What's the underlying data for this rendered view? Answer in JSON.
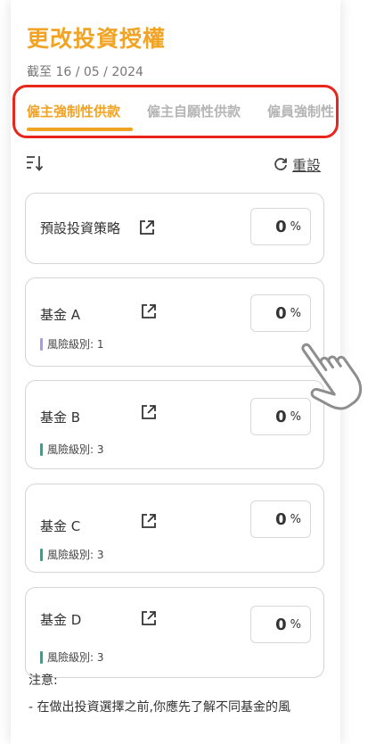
{
  "header": {
    "title": "更改投資授權",
    "date": "截至 16 / 05 / 2024"
  },
  "tabs": [
    {
      "label": "僱主強制性供款",
      "active": true
    },
    {
      "label": "僱主自願性供款",
      "active": false
    },
    {
      "label": "僱員強制性",
      "active": false
    }
  ],
  "toolbar": {
    "sort_icon": "sort-icon",
    "reset_icon": "refresh-icon",
    "reset_label": "重設"
  },
  "default_strategy": {
    "label": "預設投資策略",
    "percent": "0",
    "percent_symbol": "%"
  },
  "funds": [
    {
      "name": "基金 A",
      "risk_label": "風險級別:",
      "risk_level": "1",
      "risk_color": "#a79be8",
      "percent": "0",
      "percent_symbol": "%"
    },
    {
      "name": "基金 B",
      "risk_label": "風險級別:",
      "risk_level": "3",
      "risk_color": "#2aa783",
      "percent": "0",
      "percent_symbol": "%"
    },
    {
      "name": "基金 C",
      "risk_label": "風險級別:",
      "risk_level": "3",
      "risk_color": "#2aa783",
      "percent": "0",
      "percent_symbol": "%"
    },
    {
      "name": "基金 D",
      "risk_label": "風險級別:",
      "risk_level": "3",
      "risk_color": "#2aa783",
      "percent": "0",
      "percent_symbol": "%"
    }
  ],
  "note": {
    "title": "注意:",
    "line1": "- 在做出投資選擇之前,你應先了解不同基金的風"
  },
  "colors": {
    "accent": "#f2a323",
    "highlight_border": "#e8261c"
  }
}
